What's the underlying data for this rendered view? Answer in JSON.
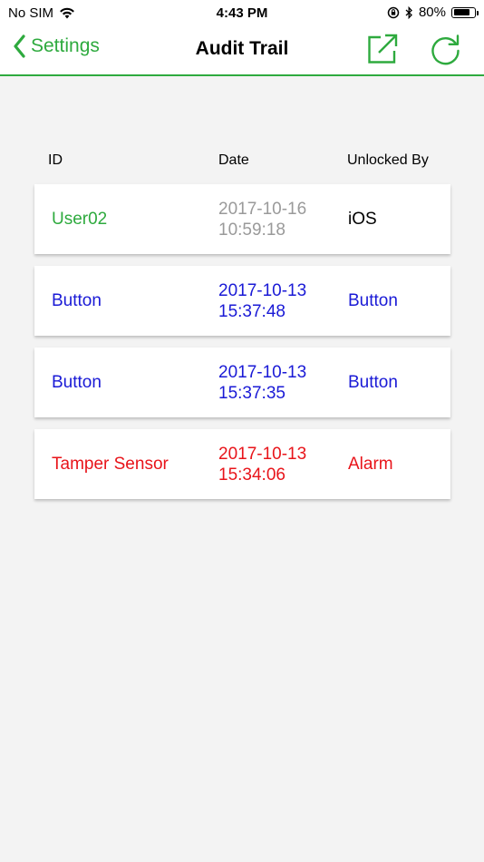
{
  "status_bar": {
    "carrier": "No SIM",
    "time": "4:43 PM",
    "battery_percent": "80%",
    "battery_level": 0.8
  },
  "nav": {
    "back_label": "Settings",
    "title": "Audit Trail",
    "accent_color": "#2eaa3e"
  },
  "table": {
    "headers": {
      "id": "ID",
      "date": "Date",
      "unlocked_by": "Unlocked By"
    },
    "rows": [
      {
        "id": "User02",
        "date_line1": "2017-10-16",
        "date_line2": "10:59:18",
        "unlocked_by": "iOS",
        "id_color": "#2eaa3e",
        "date_color": "#9a9a9a",
        "unlocked_color": "#000000"
      },
      {
        "id": "Button",
        "date_line1": "2017-10-13",
        "date_line2": "15:37:48",
        "unlocked_by": "Button",
        "id_color": "#1a1ad6",
        "date_color": "#1a1ad6",
        "unlocked_color": "#1a1ad6"
      },
      {
        "id": "Button",
        "date_line1": "2017-10-13",
        "date_line2": "15:37:35",
        "unlocked_by": "Button",
        "id_color": "#1a1ad6",
        "date_color": "#1a1ad6",
        "unlocked_color": "#1a1ad6"
      },
      {
        "id": "Tamper Sensor",
        "date_line1": "2017-10-13",
        "date_line2": "15:34:06",
        "unlocked_by": "Alarm",
        "id_color": "#e8141a",
        "date_color": "#e8141a",
        "unlocked_color": "#e8141a"
      }
    ]
  }
}
